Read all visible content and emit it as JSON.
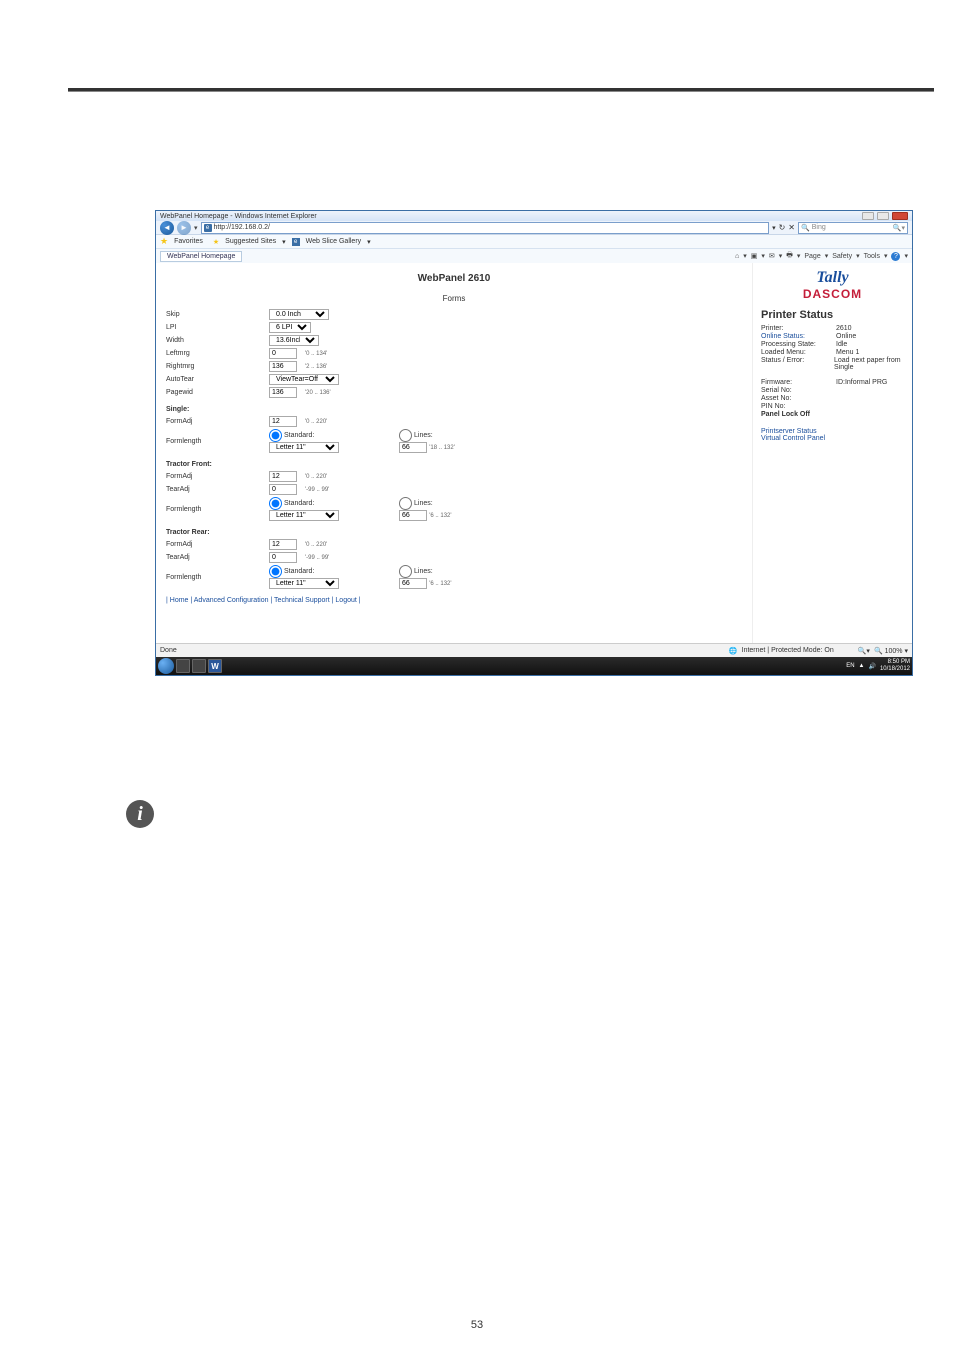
{
  "doc": {
    "page_number": "53"
  },
  "window": {
    "title": "WebPanel Homepage - Windows Internet Explorer",
    "url": "http://192.168.0.2/",
    "search_placeholder": "Bing",
    "favorites_label": "Favorites",
    "suggested_sites": "Suggested Sites",
    "web_slice": "Web Slice Gallery",
    "tab_label": "WebPanel Homepage",
    "cmd_page": "Page",
    "cmd_safety": "Safety",
    "cmd_tools": "Tools",
    "status_done": "Done",
    "status_zone": "Internet | Protected Mode: On",
    "zoom": "100%"
  },
  "page": {
    "title": "WebPanel 2610",
    "logo1": "Tally",
    "logo2": "DASCOM",
    "forms_header": "Forms",
    "footer_links": "| Home | Advanced Configuration | Technical Support | Logout |"
  },
  "forms": {
    "skip_label": "Skip",
    "skip_value": "0.0 Inch",
    "lpi_label": "LPI",
    "lpi_value": "6 LPI",
    "width_label": "Width",
    "width_value": "13.6Inch",
    "leftmrg_label": "Leftmrg",
    "leftmrg_value": "0",
    "leftmrg_hint": "'0 .. 134'",
    "rightmrg_label": "Rightmrg",
    "rightmrg_value": "136",
    "rightmrg_hint": "'2 .. 136'",
    "autotear_label": "AutoTear",
    "autotear_value": "ViewTear=Off",
    "pagewid_label": "Pagewid",
    "pagewid_value": "136",
    "pagewid_hint": "'20 .. 136'",
    "single_header": "Single:",
    "formadj_label": "FormAdj",
    "formadj_value": "12",
    "formadj_hint": "'0 .. 220'",
    "formlength_label": "Formlength",
    "standard_label": "Standard:",
    "lines_label": "Lines:",
    "standard_value": "Letter 11\"",
    "lines_value": "66",
    "lines_hint": "'18 .. 132'",
    "tf_header": "Tractor Front:",
    "tf_formadj_value": "12",
    "tf_formadj_hint": "'0 .. 220'",
    "tearadj_label": "TearAdj",
    "tf_tearadj_value": "0",
    "tf_tearadj_hint": "'-99 .. 99'",
    "tf_lines_value": "66",
    "tf_lines_hint": "'6 .. 132'",
    "tr_header": "Tractor Rear:",
    "tr_formadj_value": "12",
    "tr_formadj_hint": "'0 .. 220'",
    "tr_tearadj_value": "0",
    "tr_tearadj_hint": "'-99 .. 99'",
    "tr_lines_value": "66",
    "tr_lines_hint": "'6 .. 132'"
  },
  "status": {
    "header": "Printer Status",
    "printer_l": "Printer:",
    "printer_v": "2610",
    "online_l": "Online Status:",
    "online_v": "Online",
    "proc_l": "Processing State:",
    "proc_v": "Idle",
    "menu_l": "Loaded Menu:",
    "menu_v": "Menu 1",
    "error_l": "Status / Error:",
    "error_v": "Load next paper from Single",
    "fw_l": "Firmware:",
    "fw_v": "ID:Informal PRG",
    "serial_l": "Serial No:",
    "asset_l": "Asset No:",
    "pin_l": "PIN No:",
    "panel_l": "Panel Lock Off",
    "link1": "Printserver Status",
    "link2": "Virtual Control Panel"
  },
  "taskbar": {
    "lang": "EN",
    "time": "8:50 PM",
    "date": "10/18/2012"
  }
}
